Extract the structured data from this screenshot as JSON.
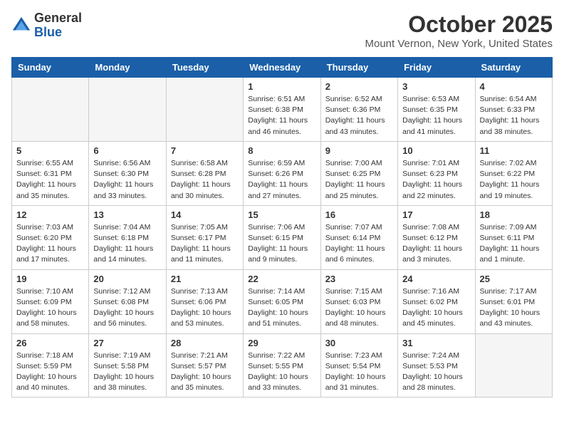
{
  "header": {
    "logo_general": "General",
    "logo_blue": "Blue",
    "month_title": "October 2025",
    "location": "Mount Vernon, New York, United States"
  },
  "days_of_week": [
    "Sunday",
    "Monday",
    "Tuesday",
    "Wednesday",
    "Thursday",
    "Friday",
    "Saturday"
  ],
  "weeks": [
    [
      {
        "day": "",
        "info": ""
      },
      {
        "day": "",
        "info": ""
      },
      {
        "day": "",
        "info": ""
      },
      {
        "day": "1",
        "info": "Sunrise: 6:51 AM\nSunset: 6:38 PM\nDaylight: 11 hours\nand 46 minutes."
      },
      {
        "day": "2",
        "info": "Sunrise: 6:52 AM\nSunset: 6:36 PM\nDaylight: 11 hours\nand 43 minutes."
      },
      {
        "day": "3",
        "info": "Sunrise: 6:53 AM\nSunset: 6:35 PM\nDaylight: 11 hours\nand 41 minutes."
      },
      {
        "day": "4",
        "info": "Sunrise: 6:54 AM\nSunset: 6:33 PM\nDaylight: 11 hours\nand 38 minutes."
      }
    ],
    [
      {
        "day": "5",
        "info": "Sunrise: 6:55 AM\nSunset: 6:31 PM\nDaylight: 11 hours\nand 35 minutes."
      },
      {
        "day": "6",
        "info": "Sunrise: 6:56 AM\nSunset: 6:30 PM\nDaylight: 11 hours\nand 33 minutes."
      },
      {
        "day": "7",
        "info": "Sunrise: 6:58 AM\nSunset: 6:28 PM\nDaylight: 11 hours\nand 30 minutes."
      },
      {
        "day": "8",
        "info": "Sunrise: 6:59 AM\nSunset: 6:26 PM\nDaylight: 11 hours\nand 27 minutes."
      },
      {
        "day": "9",
        "info": "Sunrise: 7:00 AM\nSunset: 6:25 PM\nDaylight: 11 hours\nand 25 minutes."
      },
      {
        "day": "10",
        "info": "Sunrise: 7:01 AM\nSunset: 6:23 PM\nDaylight: 11 hours\nand 22 minutes."
      },
      {
        "day": "11",
        "info": "Sunrise: 7:02 AM\nSunset: 6:22 PM\nDaylight: 11 hours\nand 19 minutes."
      }
    ],
    [
      {
        "day": "12",
        "info": "Sunrise: 7:03 AM\nSunset: 6:20 PM\nDaylight: 11 hours\nand 17 minutes."
      },
      {
        "day": "13",
        "info": "Sunrise: 7:04 AM\nSunset: 6:18 PM\nDaylight: 11 hours\nand 14 minutes."
      },
      {
        "day": "14",
        "info": "Sunrise: 7:05 AM\nSunset: 6:17 PM\nDaylight: 11 hours\nand 11 minutes."
      },
      {
        "day": "15",
        "info": "Sunrise: 7:06 AM\nSunset: 6:15 PM\nDaylight: 11 hours\nand 9 minutes."
      },
      {
        "day": "16",
        "info": "Sunrise: 7:07 AM\nSunset: 6:14 PM\nDaylight: 11 hours\nand 6 minutes."
      },
      {
        "day": "17",
        "info": "Sunrise: 7:08 AM\nSunset: 6:12 PM\nDaylight: 11 hours\nand 3 minutes."
      },
      {
        "day": "18",
        "info": "Sunrise: 7:09 AM\nSunset: 6:11 PM\nDaylight: 11 hours\nand 1 minute."
      }
    ],
    [
      {
        "day": "19",
        "info": "Sunrise: 7:10 AM\nSunset: 6:09 PM\nDaylight: 10 hours\nand 58 minutes."
      },
      {
        "day": "20",
        "info": "Sunrise: 7:12 AM\nSunset: 6:08 PM\nDaylight: 10 hours\nand 56 minutes."
      },
      {
        "day": "21",
        "info": "Sunrise: 7:13 AM\nSunset: 6:06 PM\nDaylight: 10 hours\nand 53 minutes."
      },
      {
        "day": "22",
        "info": "Sunrise: 7:14 AM\nSunset: 6:05 PM\nDaylight: 10 hours\nand 51 minutes."
      },
      {
        "day": "23",
        "info": "Sunrise: 7:15 AM\nSunset: 6:03 PM\nDaylight: 10 hours\nand 48 minutes."
      },
      {
        "day": "24",
        "info": "Sunrise: 7:16 AM\nSunset: 6:02 PM\nDaylight: 10 hours\nand 45 minutes."
      },
      {
        "day": "25",
        "info": "Sunrise: 7:17 AM\nSunset: 6:01 PM\nDaylight: 10 hours\nand 43 minutes."
      }
    ],
    [
      {
        "day": "26",
        "info": "Sunrise: 7:18 AM\nSunset: 5:59 PM\nDaylight: 10 hours\nand 40 minutes."
      },
      {
        "day": "27",
        "info": "Sunrise: 7:19 AM\nSunset: 5:58 PM\nDaylight: 10 hours\nand 38 minutes."
      },
      {
        "day": "28",
        "info": "Sunrise: 7:21 AM\nSunset: 5:57 PM\nDaylight: 10 hours\nand 35 minutes."
      },
      {
        "day": "29",
        "info": "Sunrise: 7:22 AM\nSunset: 5:55 PM\nDaylight: 10 hours\nand 33 minutes."
      },
      {
        "day": "30",
        "info": "Sunrise: 7:23 AM\nSunset: 5:54 PM\nDaylight: 10 hours\nand 31 minutes."
      },
      {
        "day": "31",
        "info": "Sunrise: 7:24 AM\nSunset: 5:53 PM\nDaylight: 10 hours\nand 28 minutes."
      },
      {
        "day": "",
        "info": ""
      }
    ]
  ]
}
